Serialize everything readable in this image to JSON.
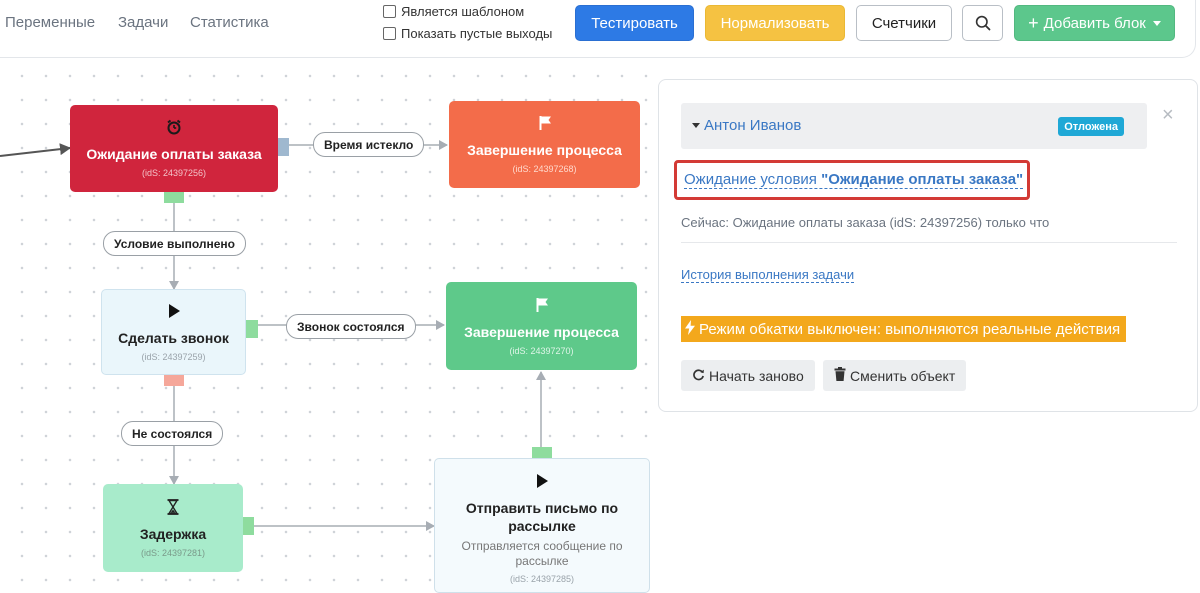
{
  "nav": {
    "items": [
      "Переменные",
      "Задачи",
      "Статистика"
    ]
  },
  "toolbar": {
    "is_template_label": "Является шаблоном",
    "show_empty_label": "Показать пустые выходы",
    "test_label": "Тестировать",
    "normalize_label": "Нормализовать",
    "counters_label": "Счетчики",
    "add_block_label": "Добавить блок"
  },
  "nodes": {
    "wait_payment": {
      "title": "Ожидание оплаты заказа",
      "id_text": "(idS: 24397256)",
      "icon": "alarm-clock-icon"
    },
    "end_process_1": {
      "title": "Завершение процесса",
      "id_text": "(idS: 24397268)",
      "icon": "flag-icon"
    },
    "make_call": {
      "title": "Сделать звонок",
      "id_text": "(idS: 24397259)",
      "icon": "play-icon"
    },
    "end_process_2": {
      "title": "Завершение процесса",
      "id_text": "(idS: 24397270)",
      "icon": "flag-icon"
    },
    "delay": {
      "title": "Задержка",
      "id_text": "(idS: 24397281)",
      "icon": "hourglass-icon"
    },
    "send_email": {
      "title": "Отправить письмо по рассылке",
      "subtitle": "Отправляется сообщение по рассылке",
      "id_text": "(idS: 24397285)",
      "icon": "play-icon"
    }
  },
  "edges": {
    "timeout": "Время истекло",
    "condition_met": "Условие выполнено",
    "call_done": "Звонок состоялся",
    "call_failed": "Не состоялся"
  },
  "panel": {
    "user_name": "Антон Иванов",
    "status_badge": "Отложена",
    "condition_prefix": "Ожидание условия ",
    "condition_name": "\"Ожидание оплаты заказа\"",
    "now_text": "Сейчас: Ожидание оплаты заказа (idS: 24397256) только что",
    "history_link": "История выполнения задачи",
    "warning_text": "Режим обкатки выключен: выполняются реальные действия",
    "restart_label": "Начать заново",
    "change_object_label": "Сменить объект"
  },
  "colors": {
    "primary_blue": "#2d7ae5",
    "warning_yellow": "#f5c242",
    "success_green": "#5cc78c",
    "node_red": "#d0253d",
    "node_orange": "#f36c4a",
    "node_green": "#5ec98a",
    "badge_blue": "#1fa8d6",
    "warning_orange": "#f3a81c",
    "highlight_red": "#d33a35"
  }
}
